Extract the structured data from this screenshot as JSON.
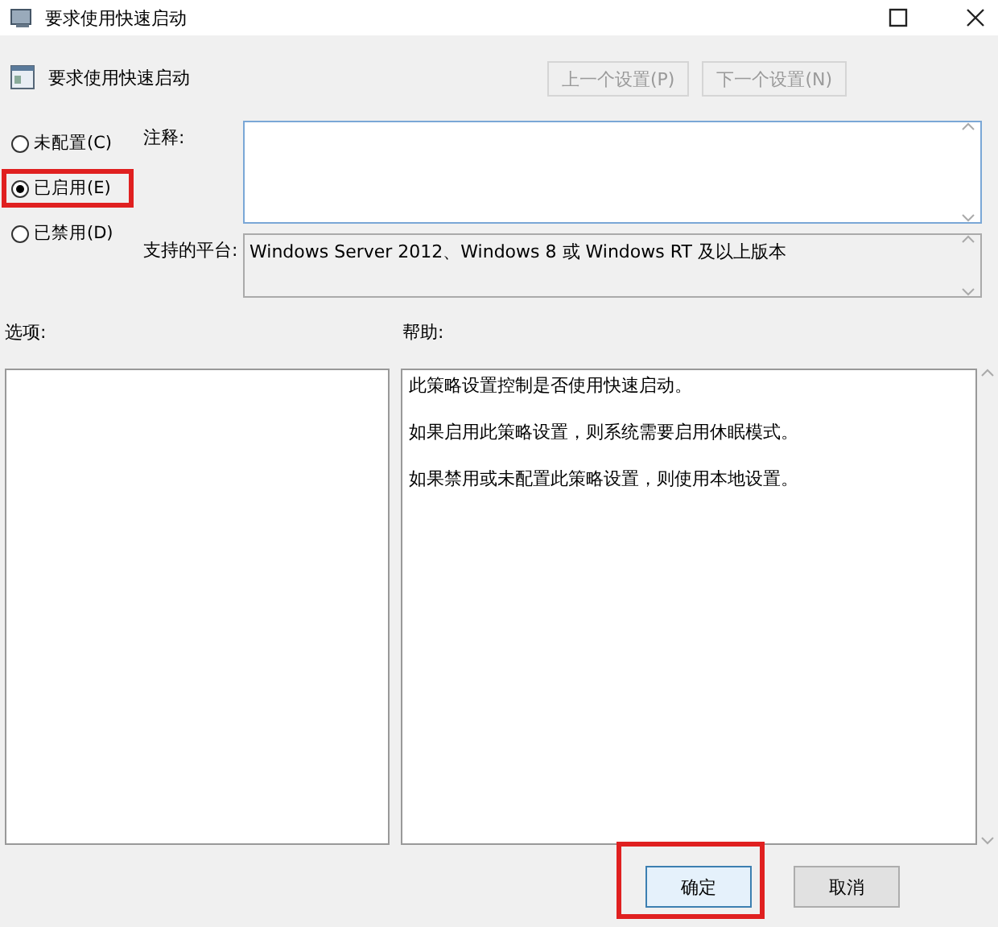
{
  "window": {
    "title": "要求使用快速启动"
  },
  "header": {
    "title": "要求使用快速启动"
  },
  "nav_buttons": [
    {
      "label": "上一个设置(P)",
      "disabled": true
    },
    {
      "label": "下一个设置(N)",
      "disabled": true
    }
  ],
  "options": [
    {
      "label": "未配置(C)",
      "selected": false,
      "highlighted": false
    },
    {
      "label": "已启用(E)",
      "selected": true,
      "highlighted": true
    },
    {
      "label": "已禁用(D)",
      "selected": false,
      "highlighted": false
    }
  ],
  "comment": {
    "label": "注释:"
  },
  "platform": {
    "label": "支持的平台:",
    "value": "Windows Server 2012、Windows 8 或 Windows RT 及以上版本"
  },
  "options_panel": {
    "label": "选项:"
  },
  "help_panel": {
    "label": "帮助:",
    "paragraphs": [
      "此策略设置控制是否使用快速启动。",
      "如果启用此策略设置，则系统需要启用休眠模式。",
      "如果禁用或未配置此策略设置，则使用本地设置。"
    ]
  },
  "footer_buttons": [
    {
      "label": "确定",
      "highlighted": true
    },
    {
      "label": "取消",
      "highlighted": false
    }
  ]
}
